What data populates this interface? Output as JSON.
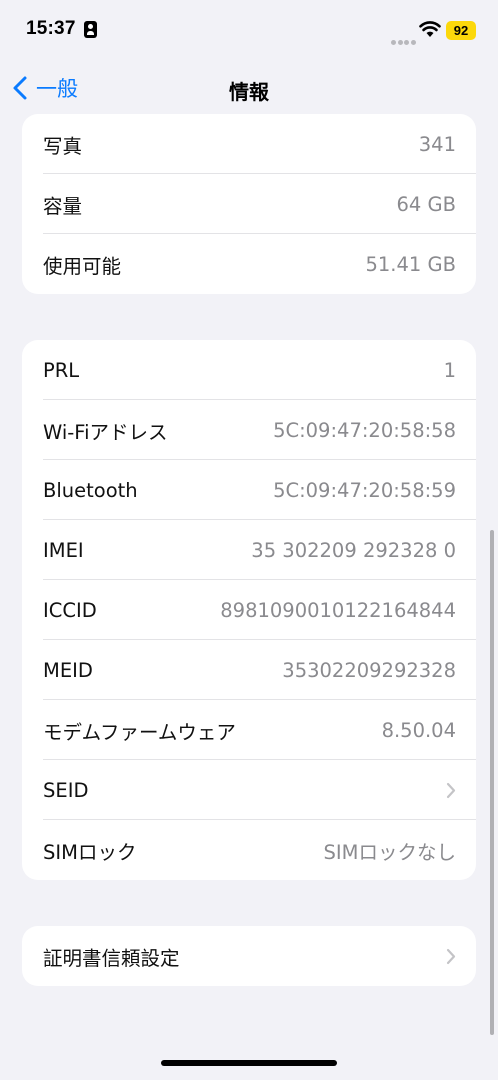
{
  "status": {
    "time": "15:37",
    "battery": "92"
  },
  "nav": {
    "back_label": "一般",
    "title": "情報"
  },
  "group1": [
    {
      "label": "写真",
      "value": "341"
    },
    {
      "label": "容量",
      "value": "64 GB"
    },
    {
      "label": "使用可能",
      "value": "51.41 GB"
    }
  ],
  "group2": [
    {
      "label": "PRL",
      "value": "1"
    },
    {
      "label": "Wi-Fiアドレス",
      "value": "5C:09:47:20:58:58"
    },
    {
      "label": "Bluetooth",
      "value": "5C:09:47:20:58:59"
    },
    {
      "label": "IMEI",
      "value": "35 302209 292328 0"
    },
    {
      "label": "ICCID",
      "value": "8981090010122164844"
    },
    {
      "label": "MEID",
      "value": "35302209292328"
    },
    {
      "label": "モデムファームウェア",
      "value": "8.50.04"
    },
    {
      "label": "SEID",
      "value": ""
    },
    {
      "label": "SIMロック",
      "value": "SIMロックなし"
    }
  ],
  "group3": [
    {
      "label": "証明書信頼設定"
    }
  ],
  "colors": {
    "accent": "#0a7bff",
    "battery": "#fcd80b",
    "background": "#f2f2f7"
  }
}
